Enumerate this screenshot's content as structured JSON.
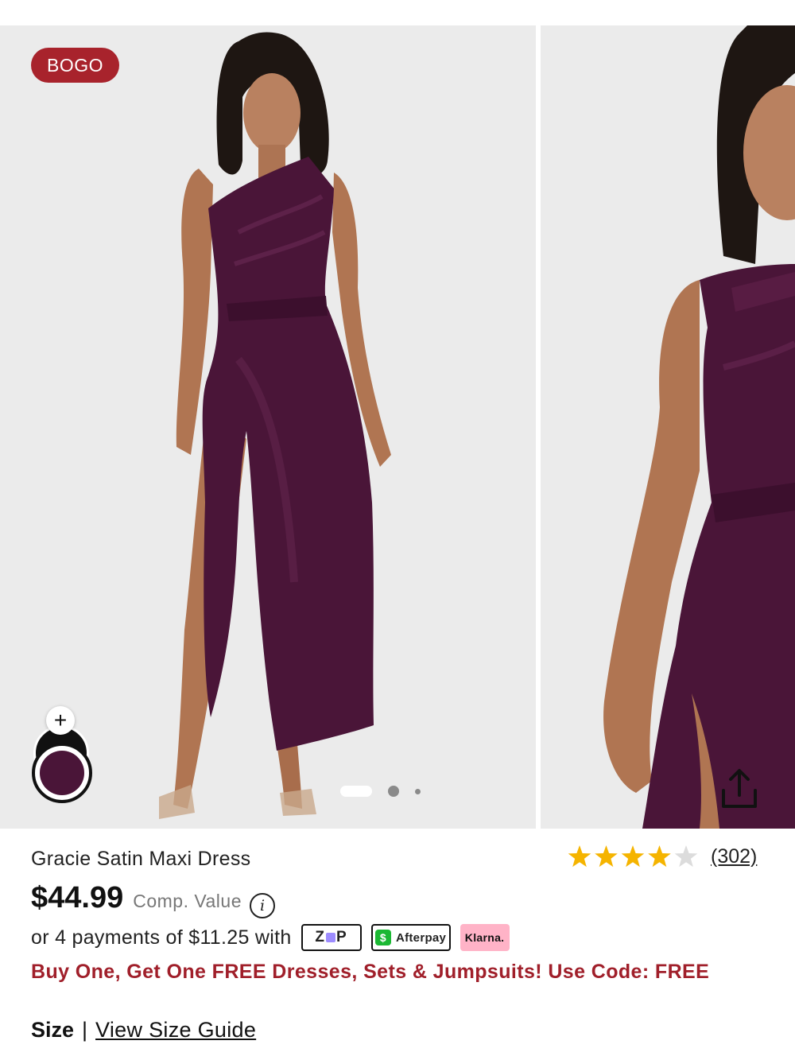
{
  "gallery": {
    "badge": "BOGO",
    "badge_color": "#a8232c",
    "background": "#ebebeb",
    "selected_swatch_color": "#4a1538",
    "plus_label": "+",
    "info_glyph": "i",
    "icons": [
      "plus-icon",
      "share-icon",
      "info-icon",
      "star-icon"
    ]
  },
  "product": {
    "title": "Gracie Satin Maxi Dress",
    "rating": 4,
    "rating_max": 5,
    "reviews": "(302)",
    "price": "$44.99",
    "comp_value": "Comp. Value",
    "installments": "or 4 payments of $11.25 with",
    "pay_zip": "ZIP",
    "pay_afterpay": "Afterpay",
    "pay_afterpay_glyph": "$",
    "pay_klarna": "Klarna.",
    "promo": "Buy One, Get One FREE Dresses, Sets & Jumpsuits! Use Code: FREE",
    "size_label": "Size",
    "size_separator": "|",
    "size_guide": "View Size Guide"
  },
  "colors": {
    "promo": "#a01f2a",
    "star_filled": "#f5b400",
    "star_empty": "#dcdcdc",
    "dress": "#4a1538",
    "skin": "#b07552",
    "hair": "#1e1612",
    "cash_green": "#1bb833",
    "klarna_pink": "#ffb3c7"
  }
}
